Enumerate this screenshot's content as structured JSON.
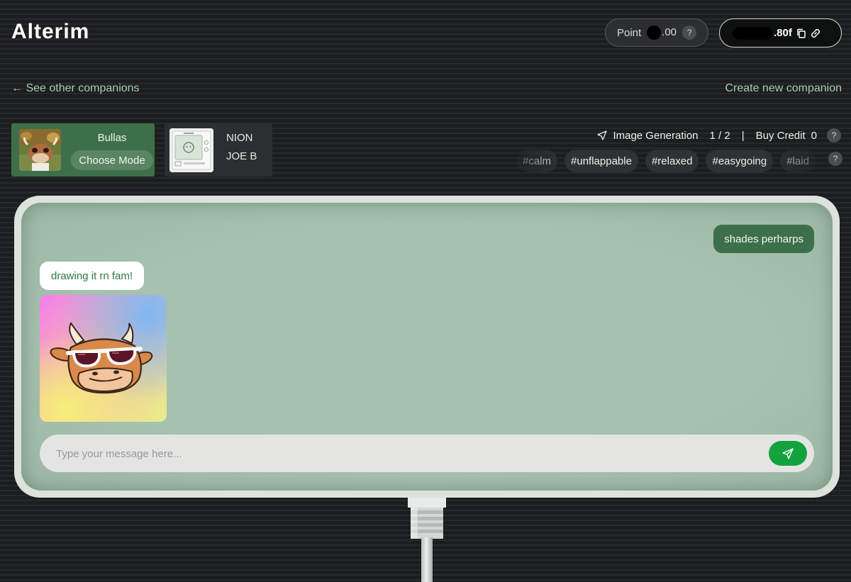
{
  "header": {
    "logo": "Alterim",
    "points_label": "Point",
    "points_value_suffix": ".00",
    "points_help": "?",
    "wallet_suffix": ".80f"
  },
  "nav": {
    "back_arrow": "←",
    "back_label": "See other companions",
    "create_label": "Create new companion"
  },
  "companions": [
    {
      "name": "Bullas",
      "mode_label": "Choose Mode",
      "active": true
    },
    {
      "line1": "NION",
      "line2": "JOE B",
      "active": false
    }
  ],
  "image_generation": {
    "label": "Image Generation",
    "count": "1 / 2",
    "separator": "|",
    "buy_credit_label": "Buy Credit",
    "credit_value": "0",
    "help": "?"
  },
  "tags": [
    "#calm",
    "#unflappable",
    "#relaxed",
    "#easygoing",
    "#laid"
  ],
  "tags_help": "?",
  "chat": {
    "messages": [
      {
        "role": "user",
        "text": "shades perharps"
      },
      {
        "role": "bot",
        "text": "drawing it rn fam!"
      }
    ],
    "input_placeholder": "Type your message here..."
  },
  "colors": {
    "accent_green": "#3e6f4b",
    "send_green": "#12a33f",
    "screen_green": "#a6c1ae",
    "link_green": "#a9cdb1"
  }
}
